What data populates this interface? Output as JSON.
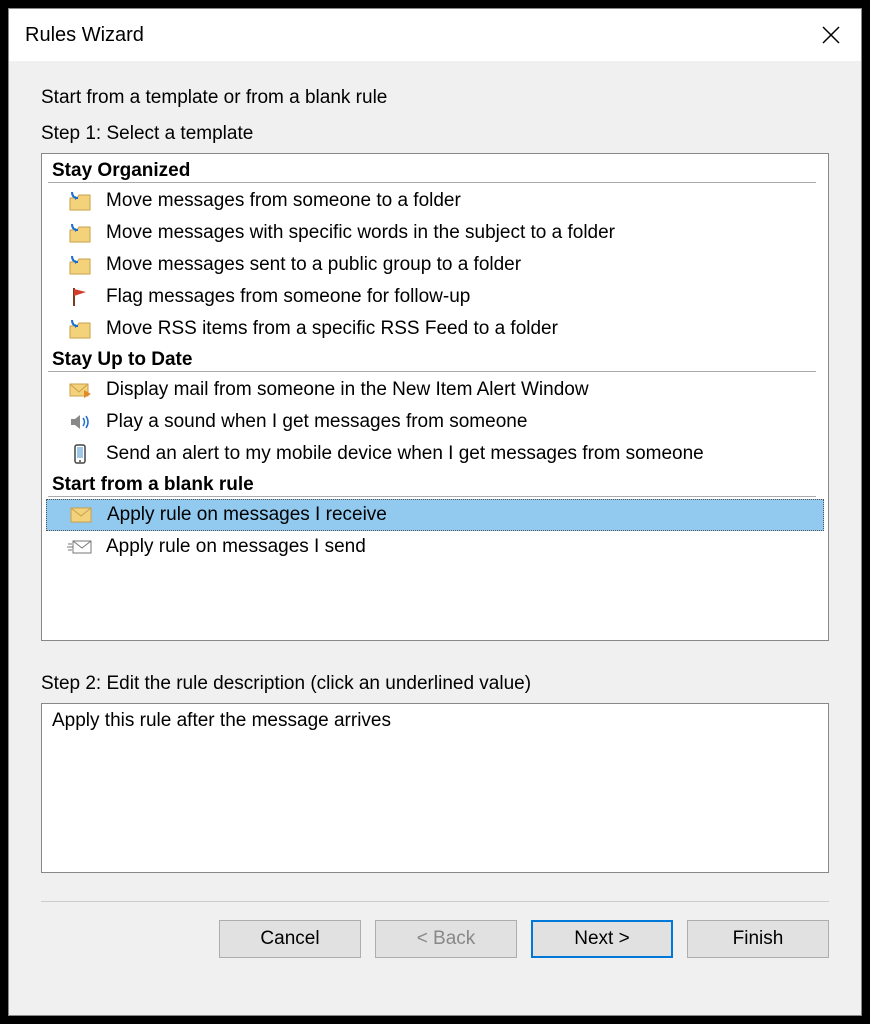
{
  "title": "Rules Wizard",
  "prompt": "Start from a template or from a blank rule",
  "step1_label": "Step 1: Select a template",
  "groups": {
    "organized_hdr": "Stay Organized",
    "uptodate_hdr": "Stay Up to Date",
    "blank_hdr": "Start from a blank rule"
  },
  "items": {
    "org1": "Move messages from someone to a folder",
    "org2": "Move messages with specific words in the subject to a folder",
    "org3": "Move messages sent to a public group to a folder",
    "org4": "Flag messages from someone for follow-up",
    "org5": "Move RSS items from a specific RSS Feed to a folder",
    "upd1": "Display mail from someone in the New Item Alert Window",
    "upd2": "Play a sound when I get messages from someone",
    "upd3": "Send an alert to my mobile device when I get messages from someone",
    "blk1": "Apply rule on messages I receive",
    "blk2": "Apply rule on messages I send"
  },
  "step2_label": "Step 2: Edit the rule description (click an underlined value)",
  "description": "Apply this rule after the message arrives",
  "buttons": {
    "cancel": "Cancel",
    "back": "<  Back",
    "next": "Next  >",
    "finish": "Finish"
  }
}
